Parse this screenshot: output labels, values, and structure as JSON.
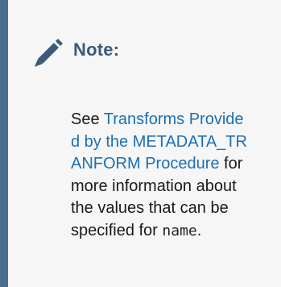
{
  "note": {
    "icon": "pencil-icon",
    "title": "Note:",
    "text_before_link": "See ",
    "link_label": "Transforms Provided by the METADATA_TRANFORM Procedure",
    "text_after_link": " for more information about the values that can be specified for ",
    "code_term": "name",
    "text_end": "."
  },
  "colors": {
    "accent_bar": "#4a6d8f",
    "title": "#3a5a78",
    "link": "#1b6fb5",
    "background": "#f6f6f6"
  }
}
